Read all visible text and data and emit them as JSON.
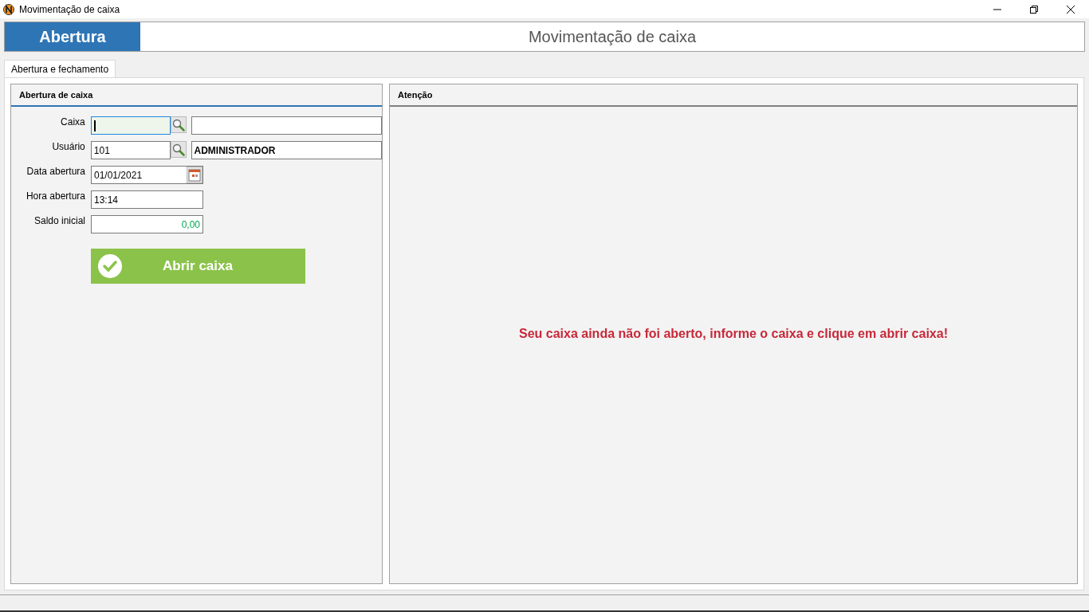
{
  "window": {
    "title": "Movimentação de caixa"
  },
  "header": {
    "badge": "Abertura",
    "title": "Movimentação de caixa"
  },
  "tabs": [
    {
      "label": "Abertura e fechamento",
      "selected": true
    }
  ],
  "opening_panel": {
    "title": "Abertura de caixa",
    "fields": [
      {
        "kind": "lookup",
        "label": "Caixa",
        "focused": true
      },
      {
        "kind": "lookup",
        "label": "Usuário",
        "value": "101",
        "description": "ADMINISTRADOR",
        "focused": false
      },
      {
        "kind": "date",
        "label": "Data abertura",
        "value": "01/01/2021",
        "focused": false
      },
      {
        "kind": "text",
        "label": "Hora abertura",
        "value": "13:14",
        "focused": false
      },
      {
        "kind": "money",
        "label": "Saldo inicial",
        "value": "0,00",
        "focused": false
      }
    ],
    "button": "Abrir caixa"
  },
  "attention_panel": {
    "title": "Atenção",
    "message": "Seu caixa ainda não foi aberto, informe o caixa e clique em abrir caixa!"
  }
}
